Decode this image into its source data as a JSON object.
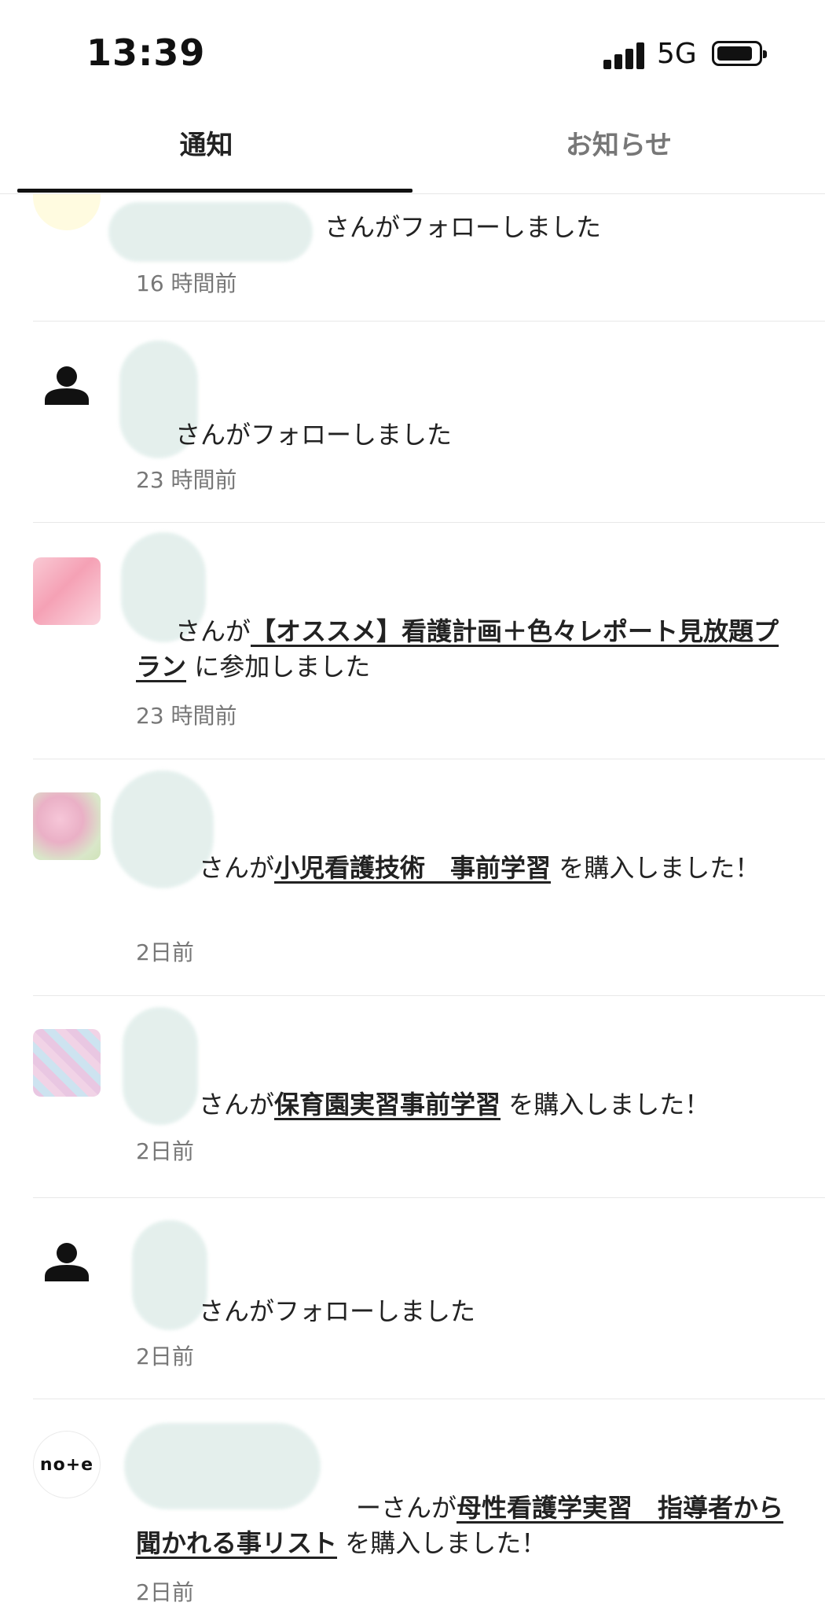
{
  "status_bar": {
    "time": "13:39",
    "network": "5G"
  },
  "tabs": [
    {
      "label": "通知",
      "active": true
    },
    {
      "label": "お知らせ",
      "active": false
    }
  ],
  "notifications": [
    {
      "avatar": "user-avatar",
      "before": "",
      "action": "さんがフォローしました",
      "link": "",
      "after": "",
      "time": "16 時間前"
    },
    {
      "avatar": "person-icon",
      "before": "",
      "action": "さんがフォローしました",
      "link": "",
      "after": "",
      "time": "23 時間前"
    },
    {
      "avatar": "nurse-plan-thumbnail",
      "before": "さんが",
      "link": "【オススメ】看護計画＋色々レポート見放題プラン",
      "after": " に参加しました",
      "time": "23 時間前"
    },
    {
      "avatar": "cherry-blossom-thumbnail",
      "before": "さんが",
      "link": "小児看護技術　事前学習",
      "after": " を購入しました！",
      "time": "2日前"
    },
    {
      "avatar": "pattern-thumbnail",
      "before": "さんが",
      "link": "保育園実習事前学習",
      "after": " を購入しました！",
      "time": "2日前"
    },
    {
      "avatar": "person-icon",
      "before": "",
      "action": "さんがフォローしました",
      "link": "",
      "after": "",
      "time": "2日前"
    },
    {
      "avatar": "note-logo",
      "logo_text": "no+e",
      "before": "ーさんが",
      "link": "母性看護学実習　指導者から聞かれる事リスト",
      "after": " を購入しました！",
      "time": "2日前"
    }
  ],
  "colors": {
    "text": "#222222",
    "muted": "#777777",
    "divider": "#e8e8e8",
    "indicator": "#111111"
  }
}
